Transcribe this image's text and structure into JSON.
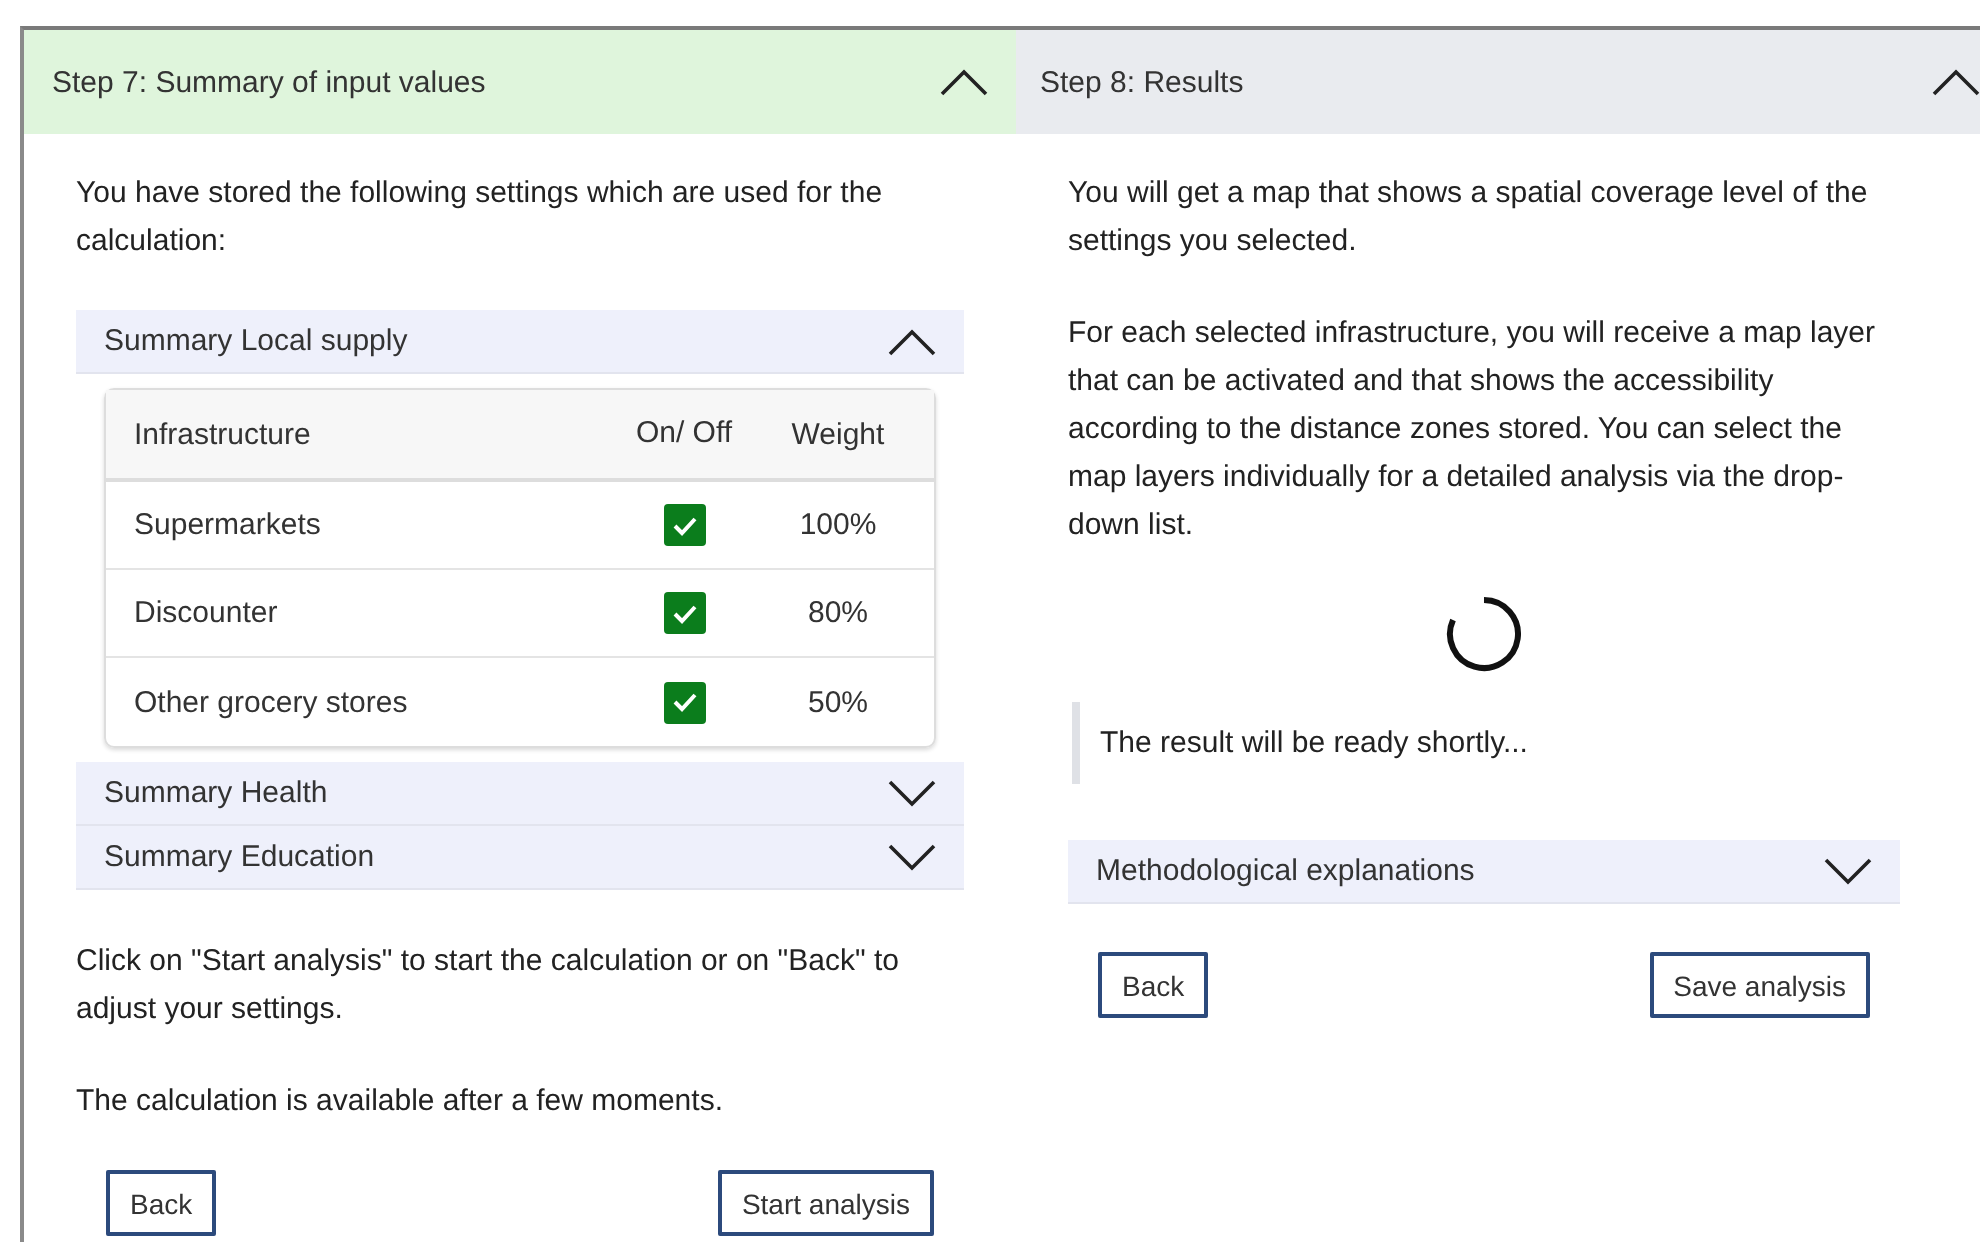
{
  "steps": [
    {
      "title": "Step 7: Summary of input values",
      "selected": true,
      "expanded": true,
      "blocks": [
        {
          "kind": "paragraph",
          "text": "You have stored the following settings which are used for the calculation:"
        },
        {
          "kind": "accordion",
          "title": "Summary Local supply",
          "expanded": true,
          "table": {
            "columns": [
              "Infrastructure",
              "On/ Off",
              "Weight"
            ],
            "rows": [
              {
                "name": "Supermarkets",
                "checked": true,
                "weight": "100%"
              },
              {
                "name": "Discounter",
                "checked": true,
                "weight": "80%"
              },
              {
                "name": "Other grocery stores",
                "checked": true,
                "weight": "50%"
              }
            ]
          }
        },
        {
          "kind": "accordion",
          "title": "Summary Health",
          "expanded": false
        },
        {
          "kind": "accordion",
          "title": "Summary Education",
          "expanded": false
        },
        {
          "kind": "paragraph",
          "text": "Click on \"Start analysis\" to start the calculation or on \"Back\" to adjust your settings."
        },
        {
          "kind": "paragraph",
          "text": "The calculation is available after a few moments."
        },
        {
          "kind": "buttons",
          "items": [
            "Back",
            "Start analysis"
          ]
        }
      ]
    },
    {
      "title": "Step 8: Results",
      "selected": false,
      "expanded": true,
      "blocks": [
        {
          "kind": "paragraph",
          "text": "You will get a map that shows a spatial coverage level of the settings you selected."
        },
        {
          "kind": "paragraph",
          "text": "For each selected infrastructure, you will receive a map layer that can be activated and that shows the accessibility according to the distance zones stored. You can select the map layers individually for a detailed analysis via the drop-down list."
        },
        {
          "kind": "spinner"
        },
        {
          "kind": "note",
          "text": "The result will be ready shortly..."
        },
        {
          "kind": "accordion",
          "title": "Methodological explanations",
          "expanded": false
        },
        {
          "kind": "buttons",
          "items": [
            "Back",
            "Save analysis"
          ]
        }
      ]
    }
  ]
}
